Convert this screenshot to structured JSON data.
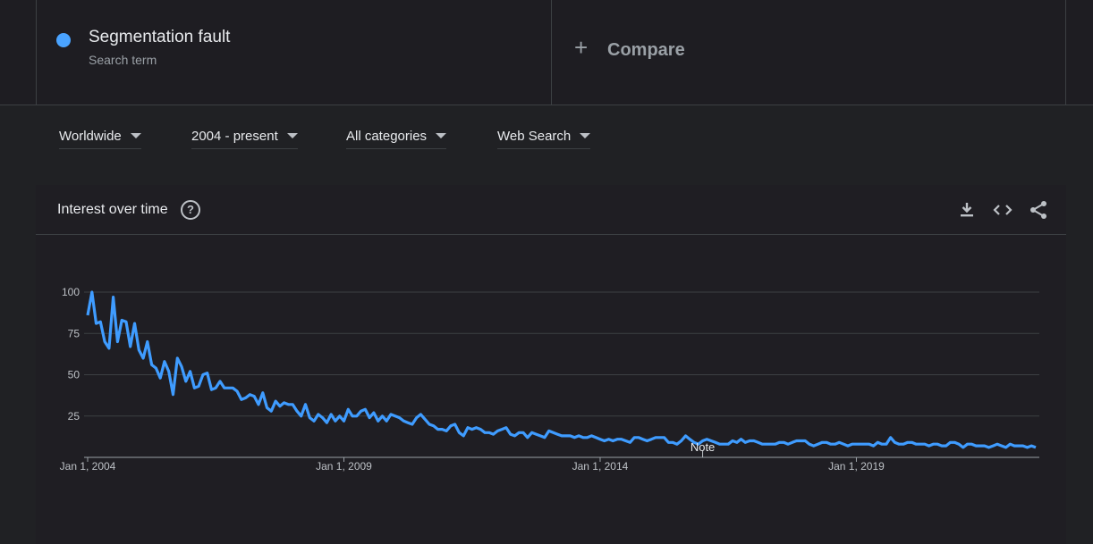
{
  "term": {
    "name": "Segmentation fault",
    "subtitle": "Search term",
    "color": "#4aa3ff"
  },
  "compare": {
    "label": "Compare"
  },
  "filters": {
    "region": "Worldwide",
    "period": "2004 - present",
    "category": "All categories",
    "search_type": "Web Search"
  },
  "card": {
    "title": "Interest over time"
  },
  "icons": {
    "help": "help-circle-icon",
    "download": "download-icon",
    "embed": "embed-code-icon",
    "share": "share-icon"
  },
  "note_label": "Note",
  "chart_data": {
    "type": "line",
    "title": "Interest over time",
    "ylim": [
      0,
      100
    ],
    "yticks": [
      25,
      50,
      75,
      100
    ],
    "xtick_labels": [
      "Jan 1, 2004",
      "Jan 1, 2009",
      "Jan 1, 2014",
      "Jan 1, 2019"
    ],
    "x_start": "2004-01",
    "x_end": "2020-12",
    "grid": true,
    "series": [
      {
        "name": "Segmentation fault",
        "color": "#3f9cff",
        "values": [
          86,
          100,
          81,
          82,
          70,
          66,
          97,
          70,
          83,
          82,
          67,
          81,
          65,
          60,
          70,
          56,
          54,
          48,
          58,
          52,
          38,
          60,
          55,
          46,
          52,
          42,
          43,
          50,
          51,
          41,
          42,
          46,
          42,
          42,
          42,
          40,
          35,
          36,
          38,
          37,
          32,
          39,
          30,
          28,
          34,
          31,
          33,
          32,
          32,
          28,
          25,
          32,
          24,
          22,
          26,
          24,
          21,
          26,
          22,
          25,
          22,
          29,
          25,
          25,
          28,
          29,
          24,
          27,
          22,
          25,
          22,
          26,
          25,
          24,
          22,
          21,
          20,
          24,
          26,
          23,
          20,
          19,
          17,
          17,
          16,
          19,
          20,
          15,
          13,
          18,
          17,
          18,
          17,
          15,
          15,
          14,
          16,
          17,
          18,
          14,
          13,
          15,
          15,
          12,
          15,
          14,
          13,
          12,
          16,
          15,
          14,
          13,
          13,
          13,
          12,
          13,
          12,
          12,
          13,
          12,
          11,
          10,
          11,
          10,
          11,
          11,
          10,
          9,
          12,
          12,
          11,
          10,
          11,
          12,
          12,
          12,
          9,
          9,
          8,
          10,
          13,
          11,
          9,
          8,
          10,
          11,
          10,
          9,
          8,
          8,
          8,
          10,
          9,
          11,
          9,
          10,
          10,
          9,
          8,
          8,
          8,
          8,
          9,
          9,
          8,
          9,
          10,
          10,
          10,
          8,
          7,
          8,
          9,
          9,
          8,
          8,
          9,
          8,
          7,
          8,
          8,
          8,
          8,
          8,
          7,
          9,
          8,
          8,
          12,
          9,
          8,
          8,
          9,
          9,
          8,
          8,
          8,
          7,
          8,
          8,
          7,
          7,
          9,
          9,
          8,
          6,
          8,
          8,
          7,
          7,
          7,
          6,
          7,
          8,
          7,
          6,
          8,
          7,
          7,
          7,
          6,
          7,
          6
        ]
      }
    ]
  }
}
